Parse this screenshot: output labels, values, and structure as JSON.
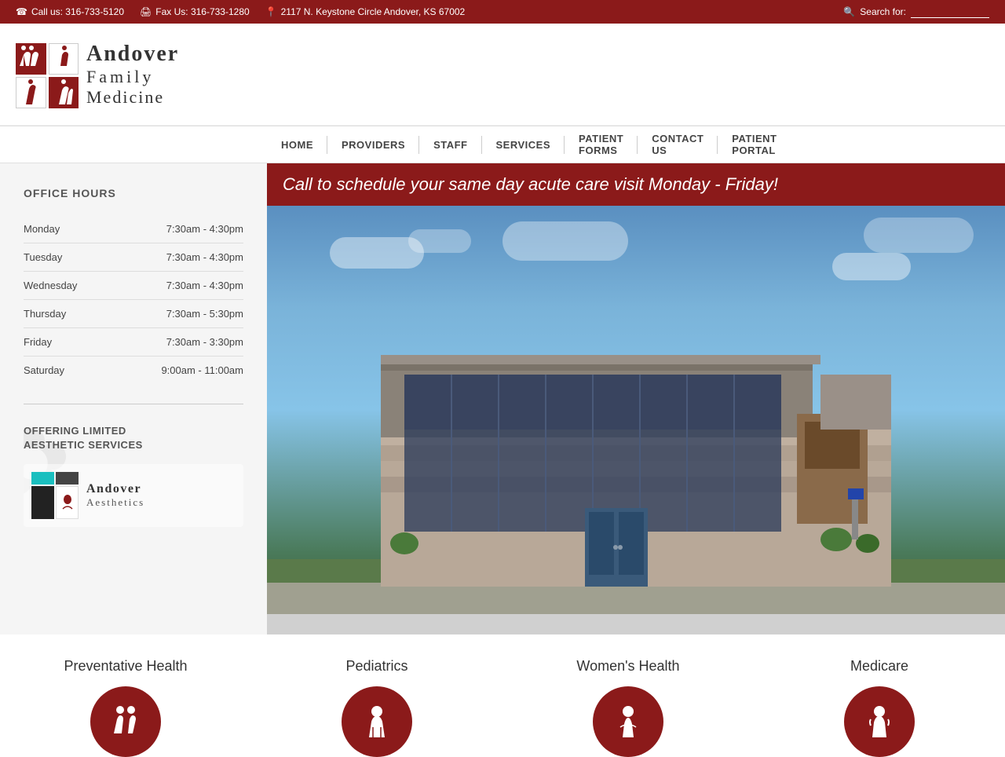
{
  "topbar": {
    "phone_icon": "☎",
    "call_label": "Call us: 316-733-5120",
    "fax_icon": "🖨",
    "fax_label": "Fax Us: 316-733-1280",
    "pin_icon": "📍",
    "address": "2117 N. Keystone Circle Andover, KS 67002",
    "search_icon": "🔍",
    "search_label": "Search for:"
  },
  "logo": {
    "andover": "Andover",
    "family": "Family",
    "medicine": "Medicine",
    "icons": [
      "👨‍👩‍👧",
      "🧍",
      "👶",
      "🧓"
    ]
  },
  "nav": {
    "items": [
      {
        "label": "HOME",
        "id": "home"
      },
      {
        "label": "PROVIDERS",
        "id": "providers"
      },
      {
        "label": "STAFF",
        "id": "staff"
      },
      {
        "label": "SERVICES",
        "id": "services"
      },
      {
        "label": "PATIENT FORMS",
        "id": "patient-forms"
      },
      {
        "label": "CONTACT US",
        "id": "contact-us"
      },
      {
        "label": "PATIENT PORTAL",
        "id": "patient-portal"
      }
    ]
  },
  "sidebar": {
    "office_hours_title": "OFFICE HOURS",
    "hours": [
      {
        "day": "Monday",
        "time": "7:30am - 4:30pm"
      },
      {
        "day": "Tuesday",
        "time": "7:30am - 4:30pm"
      },
      {
        "day": "Wednesday",
        "time": "7:30am - 4:30pm"
      },
      {
        "day": "Thursday",
        "time": "7:30am - 5:30pm"
      },
      {
        "day": "Friday",
        "time": "7:30am - 3:30pm"
      },
      {
        "day": "Saturday",
        "time": "9:00am - 11:00am"
      }
    ],
    "aesthetic_title_line1": "OFFERING LIMITED",
    "aesthetic_title_line2": "AESTHETIC SERVICES",
    "aesthetics_name1": "Andover",
    "aesthetics_name2": "Aesthetics"
  },
  "hero": {
    "banner_text": "Call to schedule your same day acute care visit Monday - Friday!"
  },
  "services": {
    "items": [
      {
        "label": "Preventative Health",
        "icon": "👨‍👩‍👧"
      },
      {
        "label": "Pediatrics",
        "icon": "👶"
      },
      {
        "label": "Women's Health",
        "icon": "🧍‍♀️"
      },
      {
        "label": "Medicare",
        "icon": "🧓"
      }
    ]
  }
}
